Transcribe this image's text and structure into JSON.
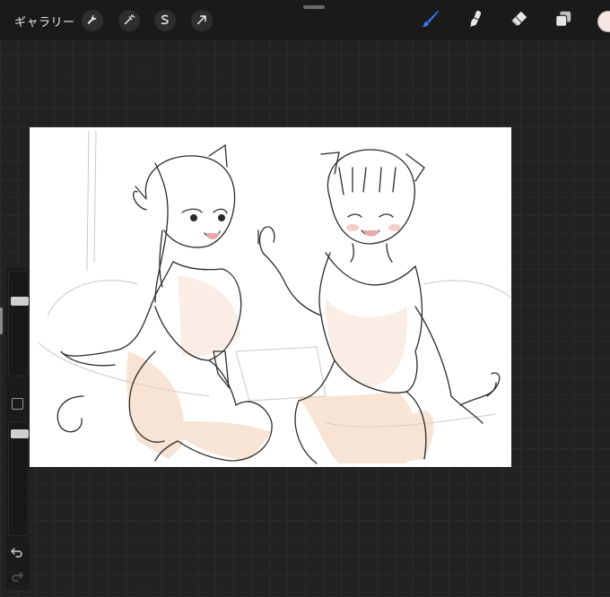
{
  "toolbar": {
    "gallery_label": "ギャラリー",
    "left_tools": [
      {
        "icon": "wrench-icon"
      },
      {
        "icon": "magic-wand-icon"
      },
      {
        "icon": "selection-icon"
      },
      {
        "icon": "transform-arrow-icon"
      }
    ],
    "right_tools": [
      {
        "icon": "brush-icon",
        "active": true,
        "color": "#3a7bff"
      },
      {
        "icon": "smudge-icon",
        "active": false
      },
      {
        "icon": "eraser-icon",
        "active": false
      },
      {
        "icon": "layers-icon",
        "active": false
      }
    ],
    "current_color": "#f7e6e4"
  },
  "sidebar": {
    "brush_size_level": 0.25,
    "opacity_level": 0.05
  },
  "colors": {
    "background": "#222222",
    "toolbar": "#1a1a1a",
    "accent": "#3a7bff",
    "skin_tone": "#f4cfb1"
  }
}
